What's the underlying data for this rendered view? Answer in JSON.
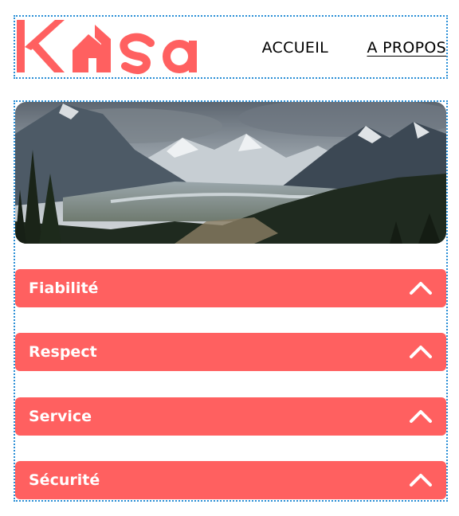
{
  "brand": {
    "logo_text": "Kasa",
    "color": "#FF6060"
  },
  "nav": {
    "links": [
      {
        "label": "ACCUEIL"
      },
      {
        "label": "A PROPOS"
      }
    ]
  },
  "banner": {
    "image": "mountain-valley-landscape"
  },
  "collapses": [
    {
      "title": "Fiabilité",
      "icon": "chevron-up-icon"
    },
    {
      "title": "Respect",
      "icon": "chevron-up-icon"
    },
    {
      "title": "Service",
      "icon": "chevron-up-icon"
    },
    {
      "title": "Sécurité",
      "icon": "chevron-up-icon"
    }
  ]
}
